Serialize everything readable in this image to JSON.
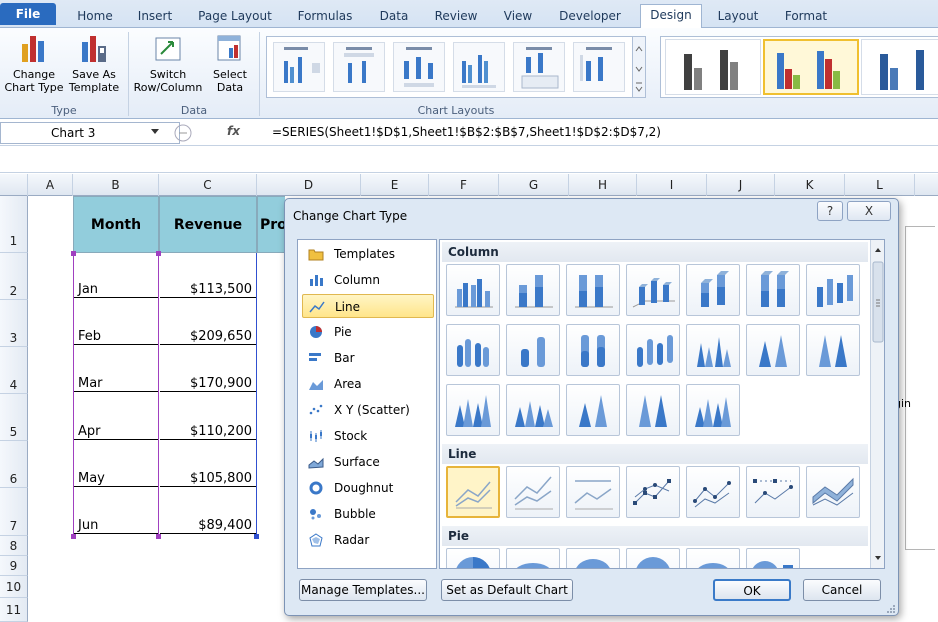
{
  "tabs": [
    "File",
    "Home",
    "Insert",
    "Page Layout",
    "Formulas",
    "Data",
    "Review",
    "View",
    "Developer",
    "Design",
    "Layout",
    "Format"
  ],
  "ribbon": {
    "change_chart_type": [
      "Change",
      "Chart Type"
    ],
    "save_as_template": [
      "Save As",
      "Template"
    ],
    "group_type": "Type",
    "switch_row_column": [
      "Switch",
      "Row/Column"
    ],
    "select_data": [
      "Select",
      "Data"
    ],
    "group_data": "Data",
    "group_chart_layouts": "Chart Layouts"
  },
  "formula_bar": {
    "name_box": "Chart 3",
    "fx": "fx",
    "formula": "=SERIES(Sheet1!$D$1,Sheet1!$B$2:$B$7,Sheet1!$D$2:$D$7,2)"
  },
  "columns": [
    "A",
    "B",
    "C",
    "D",
    "E",
    "F",
    "G",
    "H",
    "I",
    "J",
    "K",
    "L"
  ],
  "rows": [
    "1",
    "2",
    "3",
    "4",
    "5",
    "6",
    "7",
    "8",
    "9",
    "10",
    "11"
  ],
  "sheet": {
    "headers": [
      "Month",
      "Revenue",
      "Pro"
    ],
    "data": [
      {
        "month": "Jan",
        "revenue": "$113,500"
      },
      {
        "month": "Feb",
        "revenue": "$209,650"
      },
      {
        "month": "Mar",
        "revenue": "$170,900"
      },
      {
        "month": "Apr",
        "revenue": "$110,200"
      },
      {
        "month": "May",
        "revenue": "$105,800"
      },
      {
        "month": "Jun",
        "revenue": "$89,400"
      }
    ],
    "right_fragment": "gin"
  },
  "dialog": {
    "title": "Change Chart Type",
    "help": "?",
    "close": "X",
    "types": [
      "Templates",
      "Column",
      "Line",
      "Pie",
      "Bar",
      "Area",
      "X Y (Scatter)",
      "Stock",
      "Surface",
      "Doughnut",
      "Bubble",
      "Radar"
    ],
    "selected_type": "Line",
    "sections": {
      "column": "Column",
      "line": "Line",
      "pie": "Pie"
    },
    "buttons": {
      "manage_templates": "Manage Templates...",
      "set_default": "Set as Default Chart",
      "ok": "OK",
      "cancel": "Cancel"
    }
  }
}
